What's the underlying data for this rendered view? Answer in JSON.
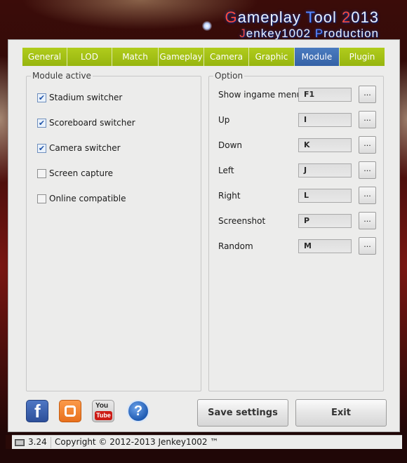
{
  "header": {
    "title_line1": "Gameplay Tool 2013",
    "title_line2": "Jenkey1002 Production"
  },
  "tabs": [
    {
      "label": "General",
      "active": false
    },
    {
      "label": "LOD",
      "active": false
    },
    {
      "label": "Match",
      "active": false
    },
    {
      "label": "Gameplay",
      "active": false
    },
    {
      "label": "Camera",
      "active": false
    },
    {
      "label": "Graphic",
      "active": false
    },
    {
      "label": "Module",
      "active": true
    },
    {
      "label": "Plugin",
      "active": false
    }
  ],
  "module_active": {
    "legend": "Module active",
    "items": [
      {
        "label": "Stadium switcher",
        "checked": true
      },
      {
        "label": "Scoreboard switcher",
        "checked": true
      },
      {
        "label": "Camera switcher",
        "checked": true
      },
      {
        "label": "Screen capture",
        "checked": false
      },
      {
        "label": "Online compatible",
        "checked": false
      }
    ]
  },
  "option": {
    "legend": "Option",
    "button_label": "...",
    "items": [
      {
        "label": "Show ingame menu",
        "key": "F1"
      },
      {
        "label": "Up",
        "key": "I"
      },
      {
        "label": "Down",
        "key": "K"
      },
      {
        "label": "Left",
        "key": "J"
      },
      {
        "label": "Right",
        "key": "L"
      },
      {
        "label": "Screenshot",
        "key": "P"
      },
      {
        "label": "Random",
        "key": "M"
      }
    ]
  },
  "footer": {
    "social_icons": [
      "facebook-icon",
      "blogger-icon",
      "youtube-icon",
      "help-icon"
    ],
    "youtube_you": "You",
    "youtube_tube": "Tube",
    "save_label": "Save settings",
    "exit_label": "Exit"
  },
  "status": {
    "version": "3.24",
    "copyright": "Copyright © 2012-2013 Jenkey1002 ™"
  },
  "colors": {
    "tab_green": "#a6c417",
    "tab_active_blue": "#3d6db3",
    "title_red": "#ff4a3a",
    "title_blue": "#5e8bff"
  }
}
